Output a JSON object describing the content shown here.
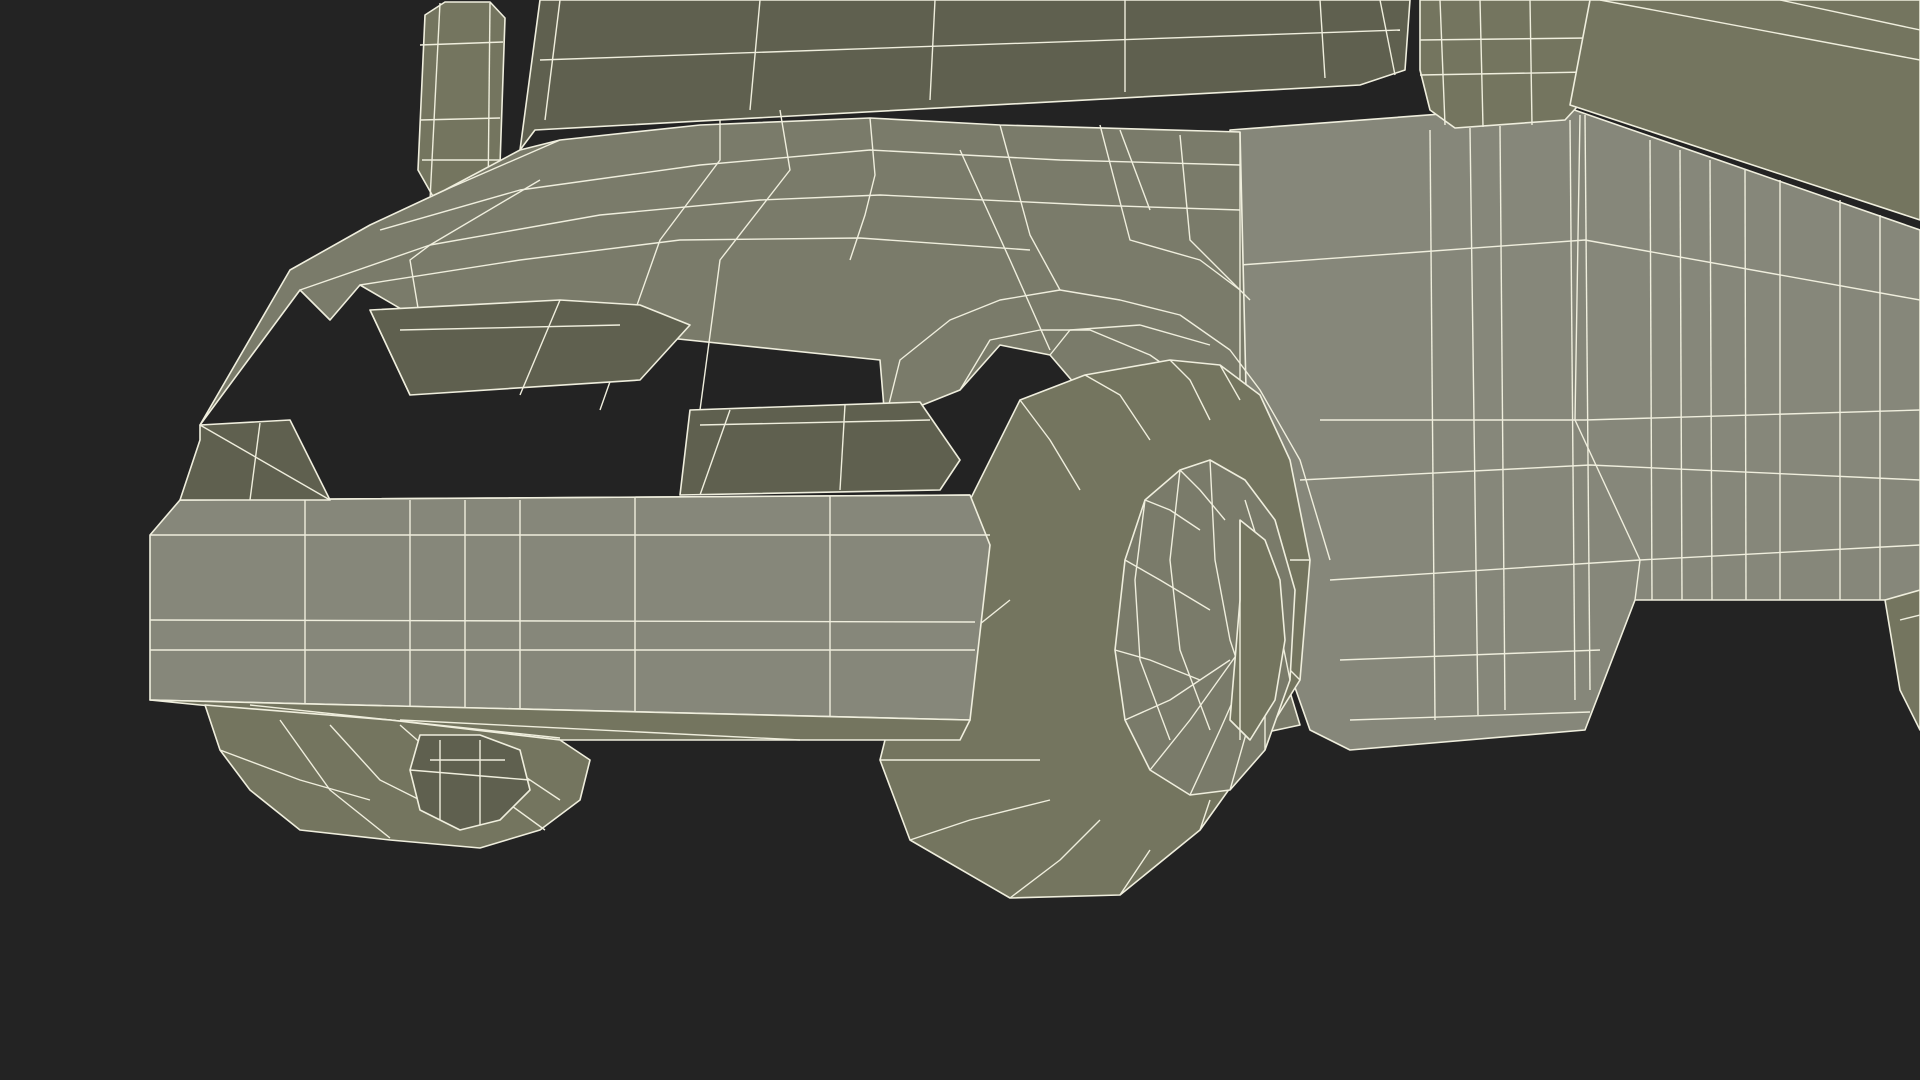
{
  "scene": {
    "subject": "wireframe-bus-front",
    "colors": {
      "background": "#232323",
      "surface": "#7a7b6a",
      "wire": "#efeedd"
    }
  }
}
